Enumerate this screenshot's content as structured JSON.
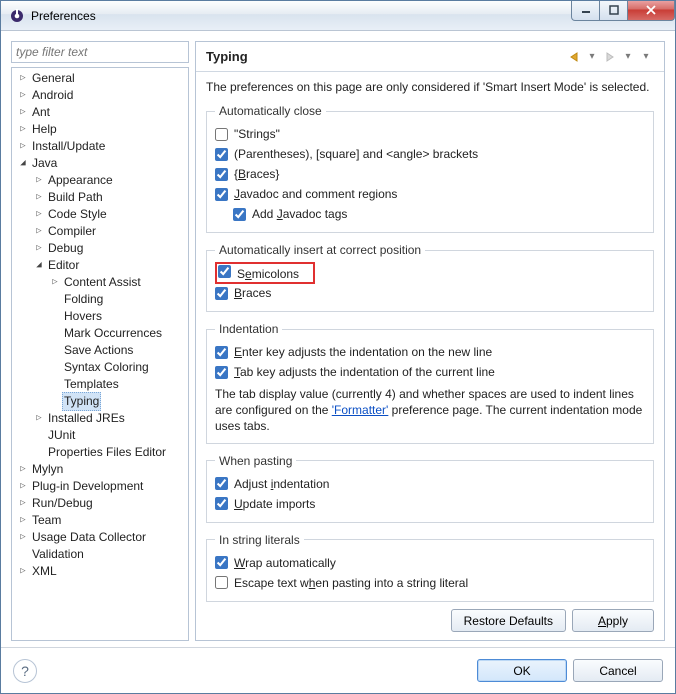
{
  "window": {
    "title": "Preferences"
  },
  "filter": {
    "placeholder": "type filter text"
  },
  "tree": [
    {
      "label": "General",
      "depth": 0,
      "expand": "closed"
    },
    {
      "label": "Android",
      "depth": 0,
      "expand": "closed"
    },
    {
      "label": "Ant",
      "depth": 0,
      "expand": "closed"
    },
    {
      "label": "Help",
      "depth": 0,
      "expand": "closed"
    },
    {
      "label": "Install/Update",
      "depth": 0,
      "expand": "closed"
    },
    {
      "label": "Java",
      "depth": 0,
      "expand": "open"
    },
    {
      "label": "Appearance",
      "depth": 1,
      "expand": "closed"
    },
    {
      "label": "Build Path",
      "depth": 1,
      "expand": "closed"
    },
    {
      "label": "Code Style",
      "depth": 1,
      "expand": "closed"
    },
    {
      "label": "Compiler",
      "depth": 1,
      "expand": "closed"
    },
    {
      "label": "Debug",
      "depth": 1,
      "expand": "closed"
    },
    {
      "label": "Editor",
      "depth": 1,
      "expand": "open"
    },
    {
      "label": "Content Assist",
      "depth": 2,
      "expand": "closed"
    },
    {
      "label": "Folding",
      "depth": 2,
      "expand": "none"
    },
    {
      "label": "Hovers",
      "depth": 2,
      "expand": "none"
    },
    {
      "label": "Mark Occurrences",
      "depth": 2,
      "expand": "none"
    },
    {
      "label": "Save Actions",
      "depth": 2,
      "expand": "none"
    },
    {
      "label": "Syntax Coloring",
      "depth": 2,
      "expand": "none"
    },
    {
      "label": "Templates",
      "depth": 2,
      "expand": "none"
    },
    {
      "label": "Typing",
      "depth": 2,
      "expand": "none",
      "selected": true
    },
    {
      "label": "Installed JREs",
      "depth": 1,
      "expand": "closed"
    },
    {
      "label": "JUnit",
      "depth": 1,
      "expand": "none"
    },
    {
      "label": "Properties Files Editor",
      "depth": 1,
      "expand": "none"
    },
    {
      "label": "Mylyn",
      "depth": 0,
      "expand": "closed"
    },
    {
      "label": "Plug-in Development",
      "depth": 0,
      "expand": "closed"
    },
    {
      "label": "Run/Debug",
      "depth": 0,
      "expand": "closed"
    },
    {
      "label": "Team",
      "depth": 0,
      "expand": "closed"
    },
    {
      "label": "Usage Data Collector",
      "depth": 0,
      "expand": "closed"
    },
    {
      "label": "Validation",
      "depth": 0,
      "expand": "none"
    },
    {
      "label": "XML",
      "depth": 0,
      "expand": "closed"
    }
  ],
  "page": {
    "title": "Typing",
    "note": "The preferences on this page are only considered if 'Smart Insert Mode' is selected.",
    "groups": {
      "autoclose": {
        "legend": "Automatically close",
        "strings": {
          "label": "\"Strings\"",
          "checked": false
        },
        "parens": {
          "label": "(Parentheses), [square] and <angle> brackets",
          "checked": true
        },
        "braces": {
          "label": "{Braces}",
          "checked": true
        },
        "javadoc": {
          "label": "Javadoc and comment regions",
          "checked": true
        },
        "addtags": {
          "label": "Add Javadoc tags",
          "checked": true
        }
      },
      "autoinsert": {
        "legend": "Automatically insert at correct position",
        "semicolons": {
          "label": "Semicolons",
          "checked": true
        },
        "braces": {
          "label": "Braces",
          "checked": true
        }
      },
      "indentation": {
        "legend": "Indentation",
        "enter": {
          "label": "Enter key adjusts the indentation on the new line",
          "checked": true
        },
        "tab": {
          "label": "Tab key adjusts the indentation of the current line",
          "checked": true
        },
        "text_before_link": "The tab display value (currently 4) and whether spaces are used to indent lines are configured on the ",
        "link": "'Formatter'",
        "text_after_link": " preference page. The current indentation mode uses tabs."
      },
      "pasting": {
        "legend": "When pasting",
        "adjust": {
          "label": "Adjust indentation",
          "checked": true
        },
        "update": {
          "label": "Update imports",
          "checked": true
        }
      },
      "strings": {
        "legend": "In string literals",
        "wrap": {
          "label": "Wrap automatically",
          "checked": true
        },
        "escape": {
          "label": "Escape text when pasting into a string literal",
          "checked": false
        }
      }
    },
    "buttons": {
      "restore": "Restore Defaults",
      "apply": "Apply"
    }
  },
  "footer": {
    "ok": "OK",
    "cancel": "Cancel"
  }
}
